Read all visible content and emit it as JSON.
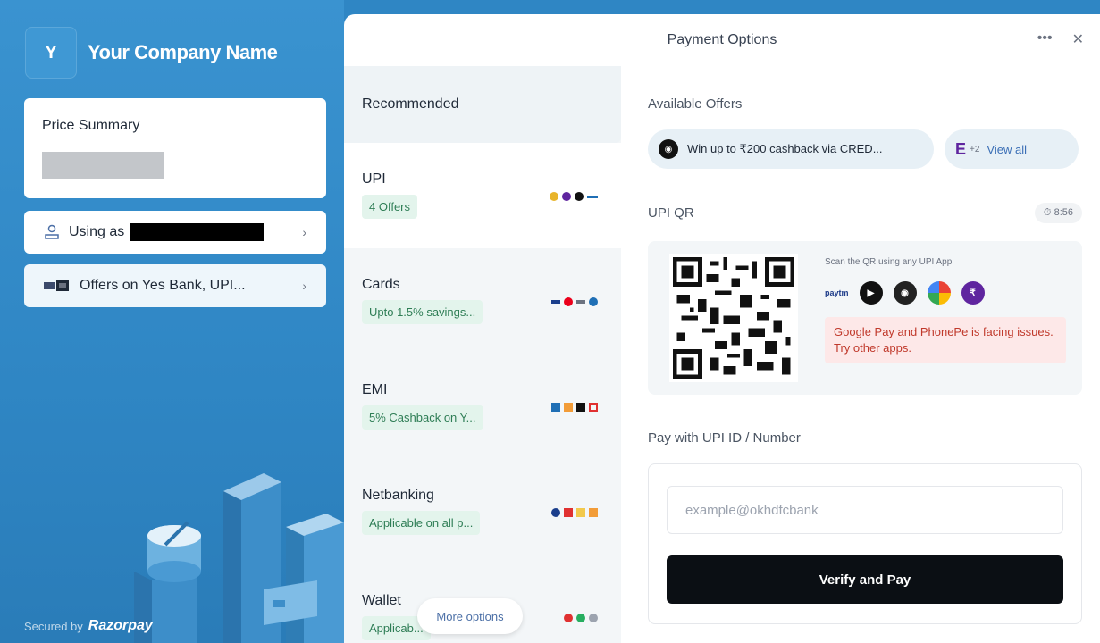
{
  "brand": {
    "logo_letter": "Y",
    "name": "Your Company Name"
  },
  "left": {
    "price_summary_title": "Price Summary",
    "using_as_label": "Using as",
    "offers_label": "Offers on Yes Bank, UPI...",
    "secured_by": "Secured by",
    "razorpay": "Razorpay"
  },
  "header": {
    "title": "Payment Options",
    "more_icon": "•••",
    "close_icon": "✕"
  },
  "methods": {
    "recommended": "Recommended",
    "items": [
      {
        "name": "UPI",
        "badge": "4 Offers"
      },
      {
        "name": "Cards",
        "badge": "Upto 1.5% savings..."
      },
      {
        "name": "EMI",
        "badge": "5% Cashback on Y..."
      },
      {
        "name": "Netbanking",
        "badge": "Applicable on all p..."
      },
      {
        "name": "Wallet",
        "badge": "Applicab..."
      }
    ],
    "more_options": "More options"
  },
  "offers": {
    "title": "Available Offers",
    "main_offer": "Win up to ₹200 cashback via CRED...",
    "extra_count": "+2",
    "view_all": "View all"
  },
  "upi_qr": {
    "title": "UPI QR",
    "timer": "8:56",
    "scan_text": "Scan the QR using any UPI App",
    "warning": "Google Pay and PhonePe is facing issues. Try other apps."
  },
  "upi_id": {
    "title": "Pay with UPI ID / Number",
    "placeholder": "example@okhdfcbank",
    "value": "",
    "verify_label": "Verify and Pay"
  },
  "colors": {
    "accent": "#2f86c4",
    "verify_bg": "#0b0f14",
    "offer_green": "#2e7d55",
    "warning_red": "#c0392b"
  }
}
